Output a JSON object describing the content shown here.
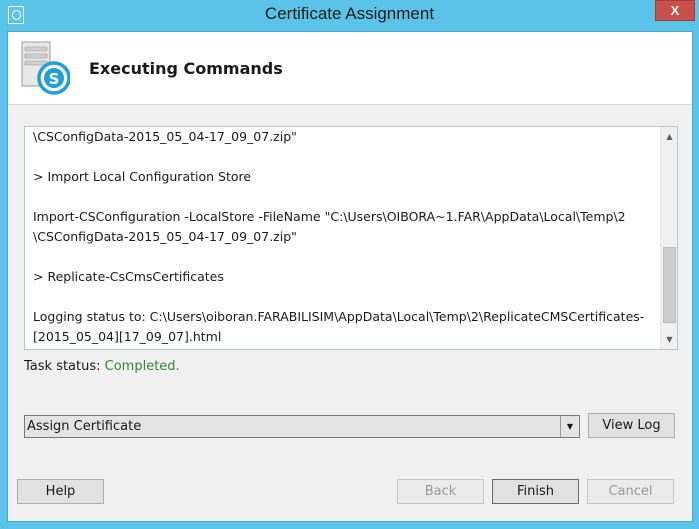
{
  "window": {
    "title": "Certificate Assignment",
    "close_label": "X"
  },
  "header": {
    "title": "Executing Commands"
  },
  "log": {
    "lines": [
      "\\CSConfigData-2015_05_04-17_09_07.zip\"",
      "",
      "> Import Local Configuration Store",
      "",
      "Import-CSConfiguration -LocalStore -FileName \"C:\\Users\\OIBORA~1.FAR\\AppData\\Local\\Temp\\2",
      "\\CSConfigData-2015_05_04-17_09_07.zip\"",
      "",
      "> Replicate-CsCmsCertificates",
      "",
      "Logging status to: C:\\Users\\oiboran.FARABILISIM\\AppData\\Local\\Temp\\2\\ReplicateCMSCertificates-",
      "[2015_05_04][17_09_07].html"
    ]
  },
  "status": {
    "label": "Task status:",
    "value": "Completed."
  },
  "action_select": {
    "selected": "Assign Certificate"
  },
  "buttons": {
    "view_log": "View Log",
    "help": "Help",
    "back": "Back",
    "finish": "Finish",
    "cancel": "Cancel"
  },
  "colors": {
    "title_bar": "#5cc3e8",
    "close_button": "#c7504a",
    "status_ok": "#2e8b2e"
  },
  "icons": {
    "window_icon": "lync-app-icon",
    "header_icon": "skype-server-icon"
  }
}
